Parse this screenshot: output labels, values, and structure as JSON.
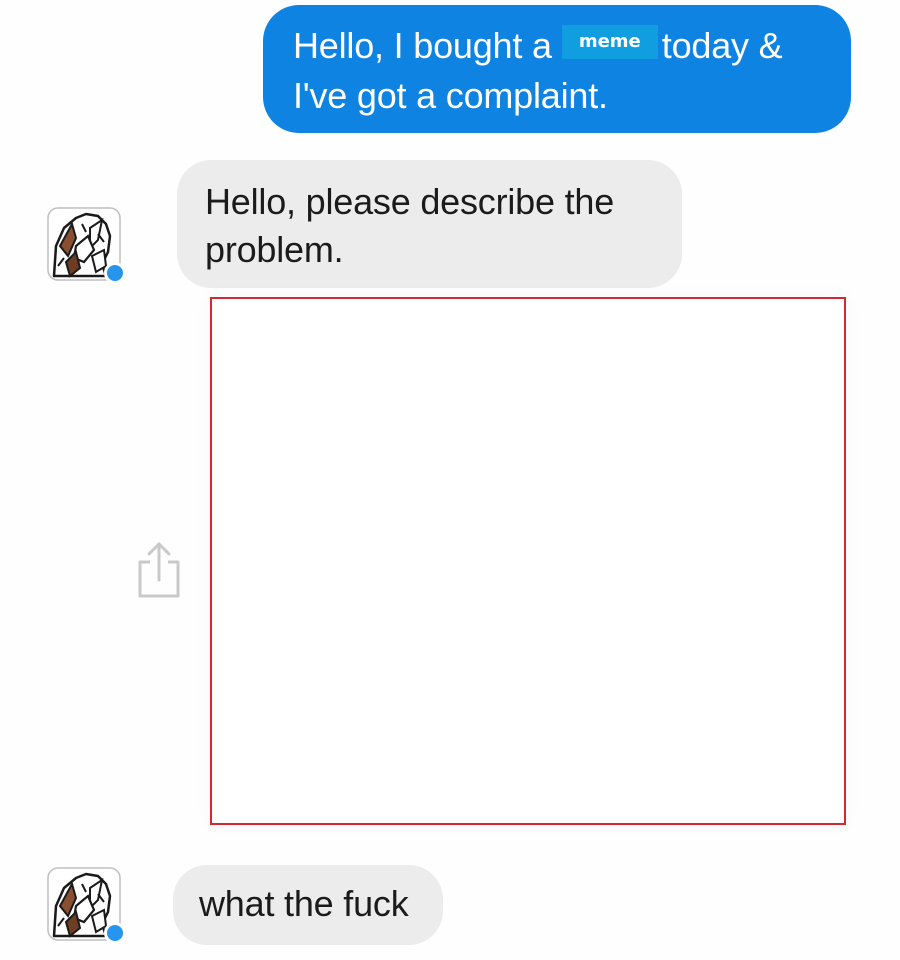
{
  "conversation": {
    "messages": [
      {
        "sender": "me",
        "lines": [
          "Hello, I bought a",
          "today &",
          "I've got a complaint."
        ],
        "redaction_label": "meme"
      },
      {
        "sender": "them",
        "lines": [
          "Hello, please describe the",
          "problem."
        ]
      },
      {
        "sender": "them",
        "lines": [
          "what the fuck"
        ]
      }
    ],
    "avatar_icon": "drawn-character-avatar-icon",
    "badge_icon": "messenger-badge-icon",
    "share_icon": "share-icon"
  },
  "colors": {
    "outgoing_bubble": "#0a84e8",
    "incoming_bubble": "#ececec",
    "redaction_box": "#0b9fe6",
    "image_frame_border": "#d9272e",
    "messenger_badge": "#2196f3"
  }
}
